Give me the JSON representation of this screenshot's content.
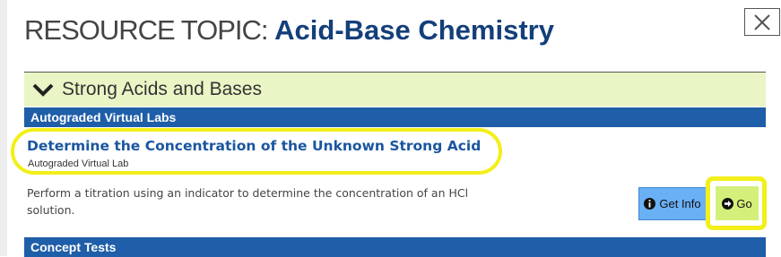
{
  "header": {
    "prefix": "RESOURCE TOPIC: ",
    "topic": "Acid-Base Chemistry"
  },
  "close": {
    "icon": "close-icon"
  },
  "section": {
    "title": "Strong Acids and Bases",
    "background": "#eaf5c6",
    "icon": "chevron-down-icon"
  },
  "categories": [
    {
      "label": "Autograded Virtual Labs"
    },
    {
      "label": "Concept Tests"
    }
  ],
  "resource": {
    "title": "Determine the Concentration of the Unknown Strong Acid",
    "type": "Autograded Virtual Lab",
    "description": "Perform a titration using an indicator to determine the concentration of an HCl solution."
  },
  "actions": {
    "info_label": "Get Info",
    "info_icon": "info-icon",
    "go_label": "Go",
    "go_icon": "arrow-right-icon"
  },
  "colors": {
    "brand_blue": "#1f5ea8",
    "title_blue": "#143f7a",
    "highlight_yellow": "#f2ef1a",
    "info_button": "#6ab0f5",
    "go_button": "#d4f07a"
  }
}
